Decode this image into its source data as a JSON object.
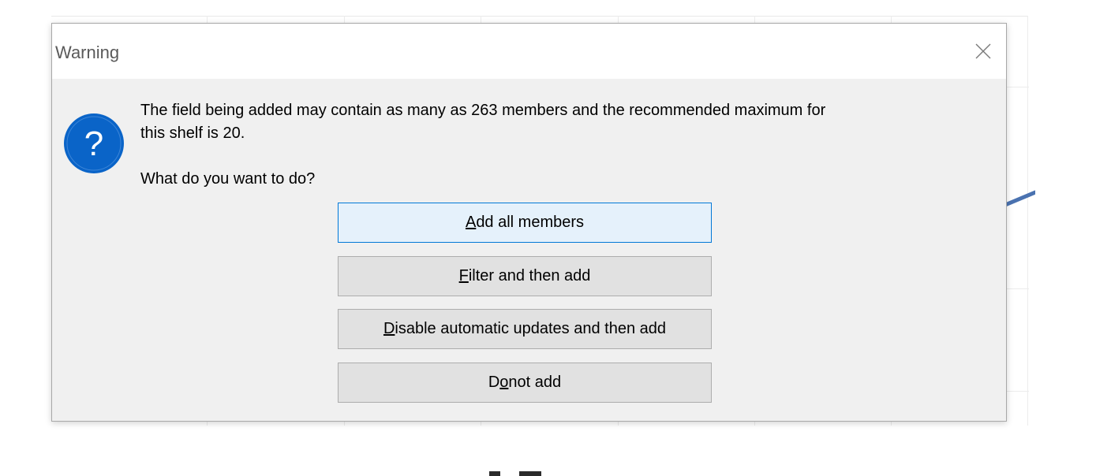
{
  "dialog": {
    "title": "Warning",
    "message_line1": "The field being added may contain as many as 263 members and the recommended maximum for",
    "message_line2": "this shelf is 20.",
    "prompt": "What do you want to do?",
    "buttons": [
      {
        "pre": "",
        "accel": "A",
        "post": "dd all members",
        "default": true
      },
      {
        "pre": "",
        "accel": "F",
        "post": "ilter and then add",
        "default": false
      },
      {
        "pre": "",
        "accel": "D",
        "post": "isable automatic updates and then add",
        "default": false
      },
      {
        "pre": "D",
        "accel": "o",
        "post": " not add",
        "default": false
      }
    ]
  },
  "icons": {
    "question": "question-mark-icon",
    "close": "close-icon"
  },
  "colors": {
    "question_icon_fill": "#0a64c8",
    "default_button_border": "#0078d7",
    "default_button_bg": "#e5f1fb",
    "button_bg": "#e1e1e1",
    "dialog_bg": "#f0f0f0",
    "trend_line": "#4a72b0"
  }
}
